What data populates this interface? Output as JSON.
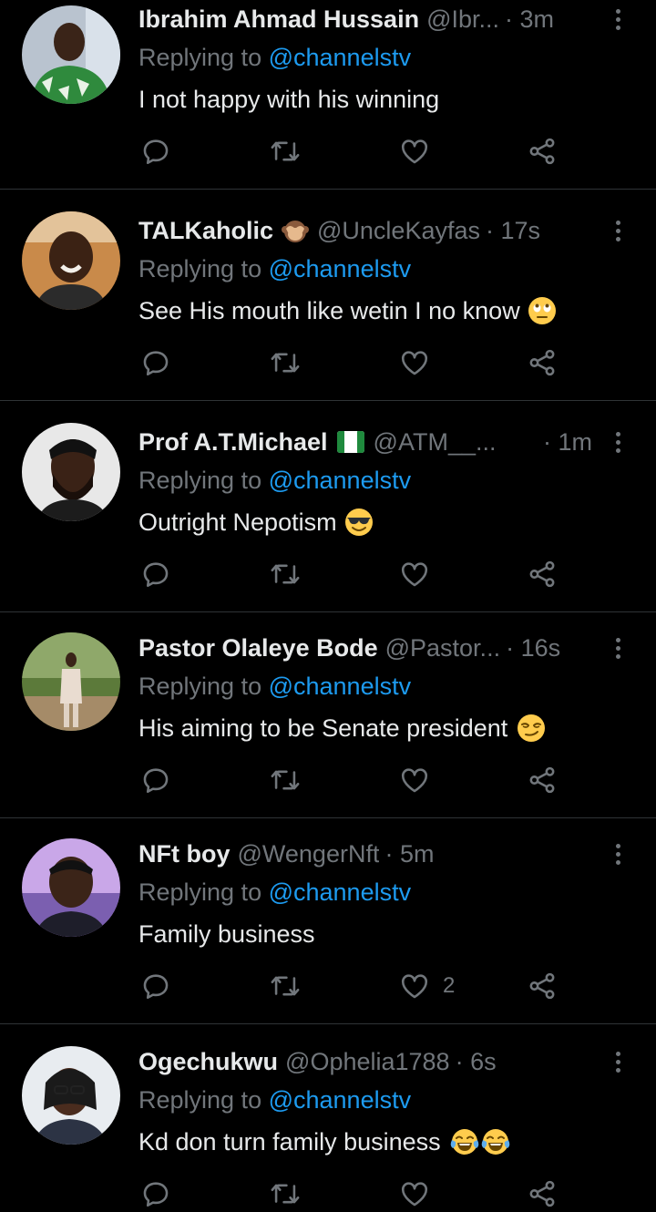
{
  "tweets": [
    {
      "name": "Ibrahim Ahmad Hussain",
      "handle": "@Ibr...",
      "time": "· 3m",
      "replying_prefix": "Replying to ",
      "replying_to": "@channelstv",
      "text": "I not happy with his winning",
      "emoji": "",
      "name_badge": "",
      "likes": ""
    },
    {
      "name": "TALKaholic",
      "handle": "@UncleKayfas",
      "time": "· 17s",
      "replying_prefix": "Replying to ",
      "replying_to": "@channelstv",
      "text": "See His mouth like wetin I no know",
      "emoji": "face-with-rolling-eyes",
      "name_badge": "see-no-evil-monkey",
      "likes": ""
    },
    {
      "name": "Prof A.T.Michael",
      "handle": "@ATM__...",
      "time": "· 1m",
      "replying_prefix": "Replying to ",
      "replying_to": "@channelstv",
      "text": "Outright Nepotism",
      "emoji": "smiling-face-with-sunglasses",
      "name_badge": "nigeria-flag",
      "likes": ""
    },
    {
      "name": "Pastor Olaleye Bode",
      "handle": "@Pastor...",
      "time": "· 16s",
      "replying_prefix": "Replying to ",
      "replying_to": "@channelstv",
      "text": "His aiming to be Senate president",
      "emoji": "smirking-face",
      "name_badge": "",
      "likes": ""
    },
    {
      "name": "NFt boy",
      "handle": "@WengerNft",
      "time": "· 5m",
      "replying_prefix": "Replying to ",
      "replying_to": "@channelstv",
      "text": "Family business",
      "emoji": "",
      "name_badge": "",
      "likes": "2"
    },
    {
      "name": "Ogechukwu",
      "handle": "@Ophelia1788",
      "time": "· 6s",
      "replying_prefix": "Replying to ",
      "replying_to": "@channelstv",
      "text": "Kd don turn family business",
      "emoji": "face-with-tears-of-joy x2",
      "name_badge": "",
      "likes": ""
    }
  ],
  "colors": {
    "background": "#000000",
    "text": "#e7e9ea",
    "muted": "#71767b",
    "link": "#1d9bf0",
    "divider": "#2f3336"
  }
}
